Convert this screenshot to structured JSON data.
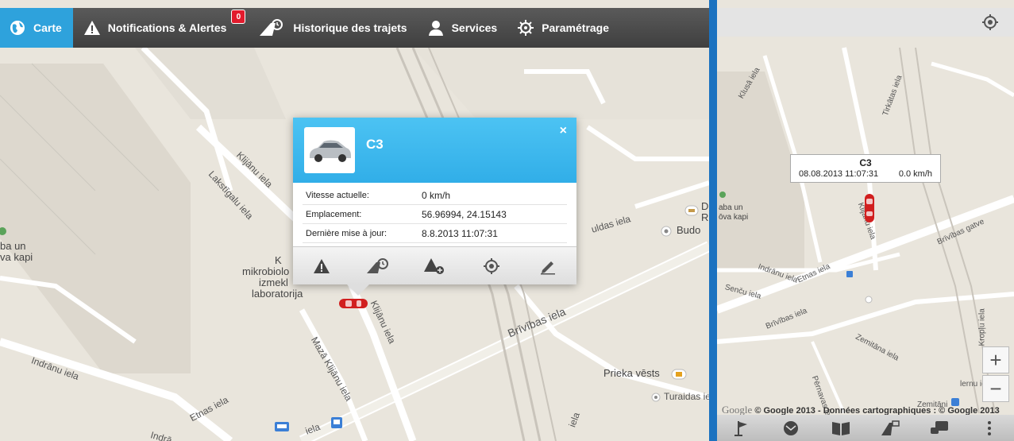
{
  "nav": {
    "items": [
      {
        "label": "Carte",
        "icon": "globe-icon",
        "active": true
      },
      {
        "label": "Notifications & Alertes",
        "icon": "warning-icon",
        "badge": "0"
      },
      {
        "label": "Historique des trajets",
        "icon": "road-history-icon"
      },
      {
        "label": "Services",
        "icon": "user-icon"
      },
      {
        "label": "Paramétrage",
        "icon": "gear-icon"
      }
    ]
  },
  "map_left": {
    "streets": [
      "Klijānu iela",
      "Lakstīgalu iela",
      "Klijānu iela",
      "Mazā Klijānu iela",
      "Brīvības iela",
      "Indrānu iela",
      "Etnas iela",
      "Indrā",
      "iela",
      "iela",
      "uldas iela",
      "Turaidas iel"
    ],
    "pois": [
      "ba un",
      "va kapi",
      "K",
      "mikrobiolo",
      "izmekl",
      "laboratorija",
      "D",
      "R",
      "Budo",
      "Prieka vēsts"
    ]
  },
  "popup": {
    "vehicle_name": "C3",
    "close": "×",
    "rows": [
      {
        "label": "Vitesse actuelle:",
        "value": "0 km/h"
      },
      {
        "label": "Emplacement:",
        "value": "56.96994, 24.15143"
      },
      {
        "label": "Dernière mise à jour:",
        "value": "8.8.2013 11:07:31"
      }
    ],
    "actions": [
      "warning-icon",
      "road-history-icon",
      "add-alert-icon",
      "locate-icon",
      "edit-icon"
    ]
  },
  "map_right": {
    "info": {
      "name": "C3",
      "datetime": "08.08.2013 11:07:31",
      "speed": "0.0 km/h"
    },
    "streets": [
      "Klusā iela",
      "Tirkātas iela",
      "Klijānu iela",
      "Brīvības gatve",
      "Indrānu iela",
      "Etnas iela",
      "Senču iela",
      "Brīvības iela",
      "Zemitāna iela",
      "Pērnavas iela",
      "Zemitāni",
      "lernu iela",
      "Kropļu iela"
    ],
    "pois": [
      "aba un",
      "R",
      "ōva kapi"
    ],
    "zoom_in": "+",
    "zoom_out": "−",
    "copyright_google": "Google",
    "copyright_text": "© Google 2013 - Données cartographiques : © Google 2013",
    "bottom_icons": [
      "flag-icon",
      "mail-icon",
      "book-icon",
      "road-icon",
      "chat-icon",
      "more-icon"
    ]
  },
  "colors": {
    "accent": "#2ea2dc",
    "popup_header": "#3db8ee",
    "divider": "#1b72c0",
    "car": "#d11f1f",
    "badge": "#e21b2d"
  }
}
